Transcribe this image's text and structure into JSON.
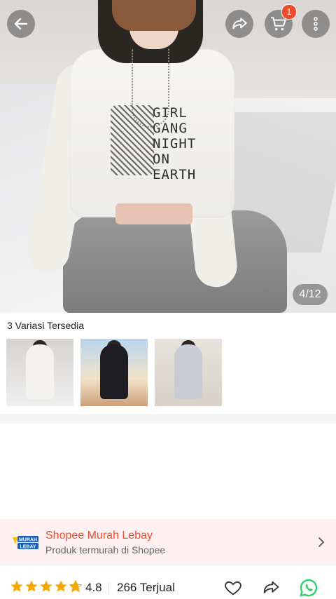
{
  "hero": {
    "print_lines": [
      "GIRL",
      "GANG",
      "NIGHT",
      "ON",
      "EARTH"
    ],
    "counter": "4/12"
  },
  "header": {
    "cart_count": "1",
    "icons": [
      "back-arrow-icon",
      "share-icon",
      "cart-icon",
      "more-vertical-icon"
    ]
  },
  "variants": {
    "title": "3 Variasi Tersedia",
    "count": 3
  },
  "promo": {
    "logo_text": [
      "MURAH",
      "LEBAY"
    ],
    "title": "Shopee Murah Lebay",
    "subtitle": "Produk termurah di Shopee",
    "accent": "#ee4d2d"
  },
  "bottom_bar": {
    "rating": "4.8",
    "rating_value": 4.8,
    "sold": "266 Terjual",
    "star_color": "#f6a700",
    "whatsapp_color": "#25d366"
  }
}
